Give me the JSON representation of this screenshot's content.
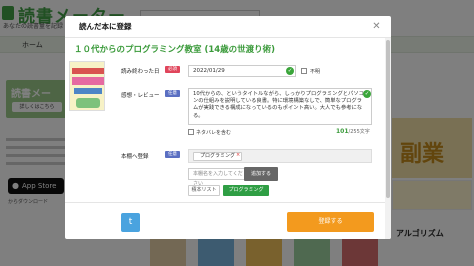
{
  "background": {
    "logo_text": "読書メーター",
    "tagline": "あなたの読書量を記録・管理",
    "nav_home": "ホーム",
    "banner_text": "読書メー",
    "banner_button": "詳しくはこちら",
    "appstore_label": "App Store",
    "appstore_sub": "からダウンロード",
    "right_book_text": "副業",
    "right_book3_text": "アルゴリズム"
  },
  "modal": {
    "title": "読んだ本に登録",
    "close_icon": "close-icon",
    "book_title": "１０代からのプログラミング教室 (14歳の世渡り術)",
    "date": {
      "label": "読み終わった日",
      "required_tag": "必須",
      "value": "2022/01/29",
      "unknown_label": "不明"
    },
    "review": {
      "label": "感想・レビュー",
      "optional_tag": "任意",
      "text": "10代からの、というタイトルながら、しっかりプログラミングとパソコンの仕組みを説明している良書。特に環境構築なしで、簡単なプログラムが実践できる構成になっているのもポイント高い。大人でも参考になる。",
      "netabare_label": "ネタバレを含む",
      "count": "101",
      "max": "/255文字"
    },
    "shelf": {
      "label": "本棚へ登録",
      "optional_tag": "任意",
      "chips": [
        "プログラミング"
      ],
      "input_placeholder": "本棚名を入力してください",
      "add_button": "追加する",
      "unregistered_chip": "積本リスト",
      "selected_chip": "プログラミング"
    },
    "twitter_icon": "twitter-icon",
    "submit_label": "登録する"
  },
  "colors": {
    "accent_green": "#3a9a3a",
    "required_red": "#e0455b",
    "optional_blue": "#5a6fc2",
    "submit_orange": "#f39a1e",
    "twitter_blue": "#4aa3df"
  }
}
